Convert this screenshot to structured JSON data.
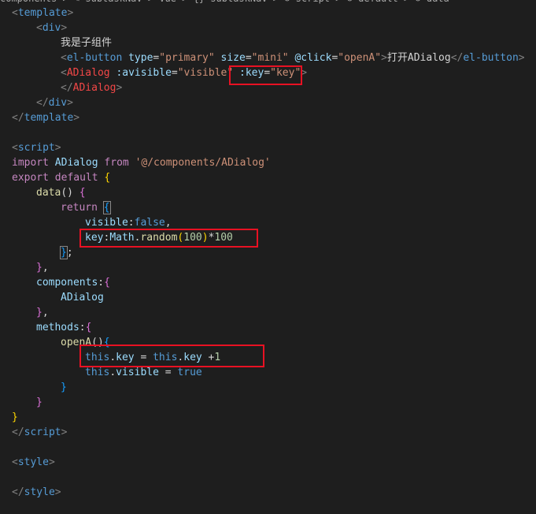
{
  "breadcrumb": "components > ✎ subtaskNav > Vue > {} subtaskNav > ⊘ script > ⊘ default > ⊘ data",
  "code": {
    "l1": {
      "open": "<",
      "tag": "template",
      "close": ">"
    },
    "l2": {
      "open": "<",
      "tag": "div",
      "close": ">"
    },
    "l3": {
      "text": "我是子组件"
    },
    "l4": {
      "open": "<",
      "tag": "el-button",
      "attr1": "type",
      "eq1": "=",
      "val1": "\"primary\"",
      "attr2": "size",
      "eq2": "=",
      "val2": "\"mini\"",
      "attr3": "@click",
      "eq3": "=",
      "val3": "\"openA\"",
      "close": ">",
      "text": "打开ADialog",
      "endopen": "</",
      "endtag": "el-button",
      "endclose": ">"
    },
    "l5": {
      "open": "<",
      "tag": "ADialog",
      "attr1": ":avisible",
      "eq1": "=",
      "val1": "\"visible\"",
      "attr2": ":key",
      "eq2": "=",
      "val2": "\"key\"",
      "close": ">"
    },
    "l6": {
      "open": "</",
      "tag": "ADialog",
      "close": ">"
    },
    "l7": {
      "open": "</",
      "tag": "div",
      "close": ">"
    },
    "l8": {
      "open": "</",
      "tag": "template",
      "close": ">"
    },
    "l10": {
      "open": "<",
      "tag": "script",
      "close": ">"
    },
    "l11": {
      "kw1": "import",
      "name": "ADialog",
      "kw2": "from",
      "str": "'@/components/ADialog'"
    },
    "l12": {
      "kw1": "export",
      "kw2": "default",
      "brace": "{"
    },
    "l13": {
      "fn": "data",
      "parens": "()",
      "brace": "{"
    },
    "l14": {
      "kw": "return",
      "brace": "{"
    },
    "l15": {
      "prop": "visible",
      "colon": ":",
      "val": "false",
      "comma": ","
    },
    "l16": {
      "prop": "key",
      "colon": ":",
      "obj": "Math",
      "dot": ".",
      "fn": "random",
      "lp": "(",
      "num1": "100",
      "rp": ")",
      "op": "*",
      "num2": "100"
    },
    "l17": {
      "brace": "}",
      "semi": ";"
    },
    "l18": {
      "brace": "}",
      "comma": ","
    },
    "l19": {
      "prop": "components",
      "colon": ":",
      "brace": "{"
    },
    "l20": {
      "name": "ADialog"
    },
    "l21": {
      "brace": "}",
      "comma": ","
    },
    "l22": {
      "prop": "methods",
      "colon": ":",
      "brace": "{"
    },
    "l23": {
      "fn": "openA",
      "parens": "()",
      "brace": "{"
    },
    "l24": {
      "this1": "this",
      "dot1": ".",
      "prop1": "key",
      "eq": " = ",
      "this2": "this",
      "dot2": ".",
      "prop2": "key",
      "rest": " +",
      "num": "1"
    },
    "l25": {
      "this": "this",
      "dot": ".",
      "prop": "visible",
      "eq": " = ",
      "val": "true"
    },
    "l26": {
      "brace": "}"
    },
    "l27": {
      "brace": "}"
    },
    "l28": {
      "brace": "}"
    },
    "l29": {
      "open": "</",
      "tag": "script",
      "close": ">"
    },
    "l31": {
      "open": "<",
      "tag": "style",
      "close": ">"
    },
    "l33": {
      "open": "</",
      "tag": "style",
      "close": ">"
    }
  },
  "highlight_color": "#e81123"
}
